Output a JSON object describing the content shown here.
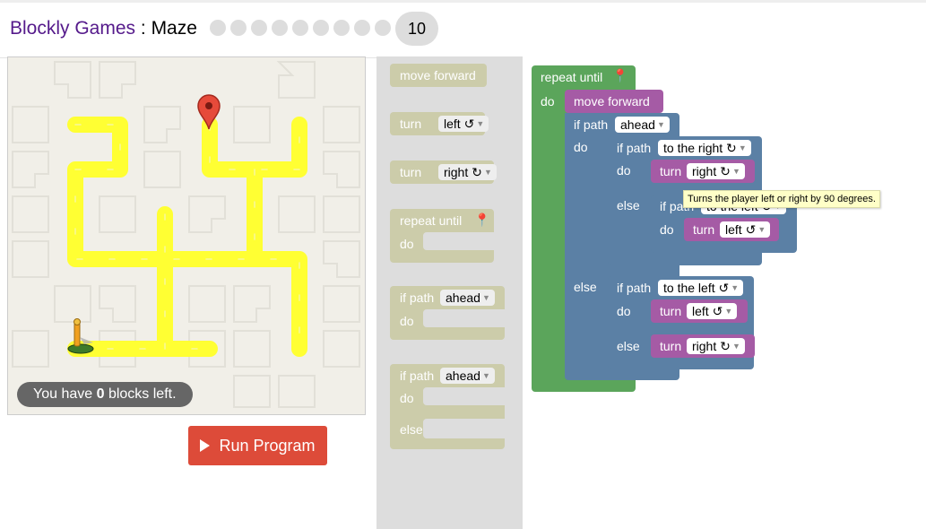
{
  "header": {
    "brand": "Blockly Games",
    "separator": " : ",
    "app": "Maze",
    "level_count_dots": 9,
    "current_level": "10"
  },
  "maze": {
    "capacity_prefix": "You have ",
    "capacity_count": "0",
    "capacity_suffix": " blocks left."
  },
  "run_button": {
    "label": "Run Program"
  },
  "toolbox": {
    "move_forward": "move forward",
    "turn_left": {
      "label": "turn",
      "dir": "left ↺"
    },
    "turn_right": {
      "label": "turn",
      "dir": "right ↻"
    },
    "repeat_until": {
      "label": "repeat until",
      "do": "do"
    },
    "if_path": {
      "label": "if path",
      "dir": "ahead",
      "do": "do"
    },
    "if_else": {
      "label": "if path",
      "dir": "ahead",
      "do": "do",
      "else": "else"
    }
  },
  "workspace": {
    "repeat_label": "repeat until",
    "repeat_do": "do",
    "move_forward": "move forward",
    "if1": {
      "label": "if path",
      "dir": "ahead",
      "do": "do",
      "else": "else"
    },
    "if2": {
      "label": "if path",
      "dir": "to the right ↻",
      "do": "do",
      "else": "else"
    },
    "turn_a": {
      "label": "turn",
      "dir": "right ↻"
    },
    "if3": {
      "label": "if path",
      "dir": "to the left ↺",
      "do": "do"
    },
    "turn_b": {
      "label": "turn",
      "dir": "left ↺"
    },
    "if4": {
      "label": "if path",
      "dir": "to the left ↺",
      "do": "do",
      "else": "else"
    },
    "turn_c": {
      "label": "turn",
      "dir": "left ↺"
    },
    "turn_d": {
      "label": "turn",
      "dir": "right ↻"
    }
  },
  "tooltip": "Turns the player left or right by 90 degrees.",
  "colors": {
    "loop": "#5ba55b",
    "logic": "#5b80a5",
    "action": "#a55ba5",
    "path": "#ffff33",
    "run": "#dd4b39"
  }
}
